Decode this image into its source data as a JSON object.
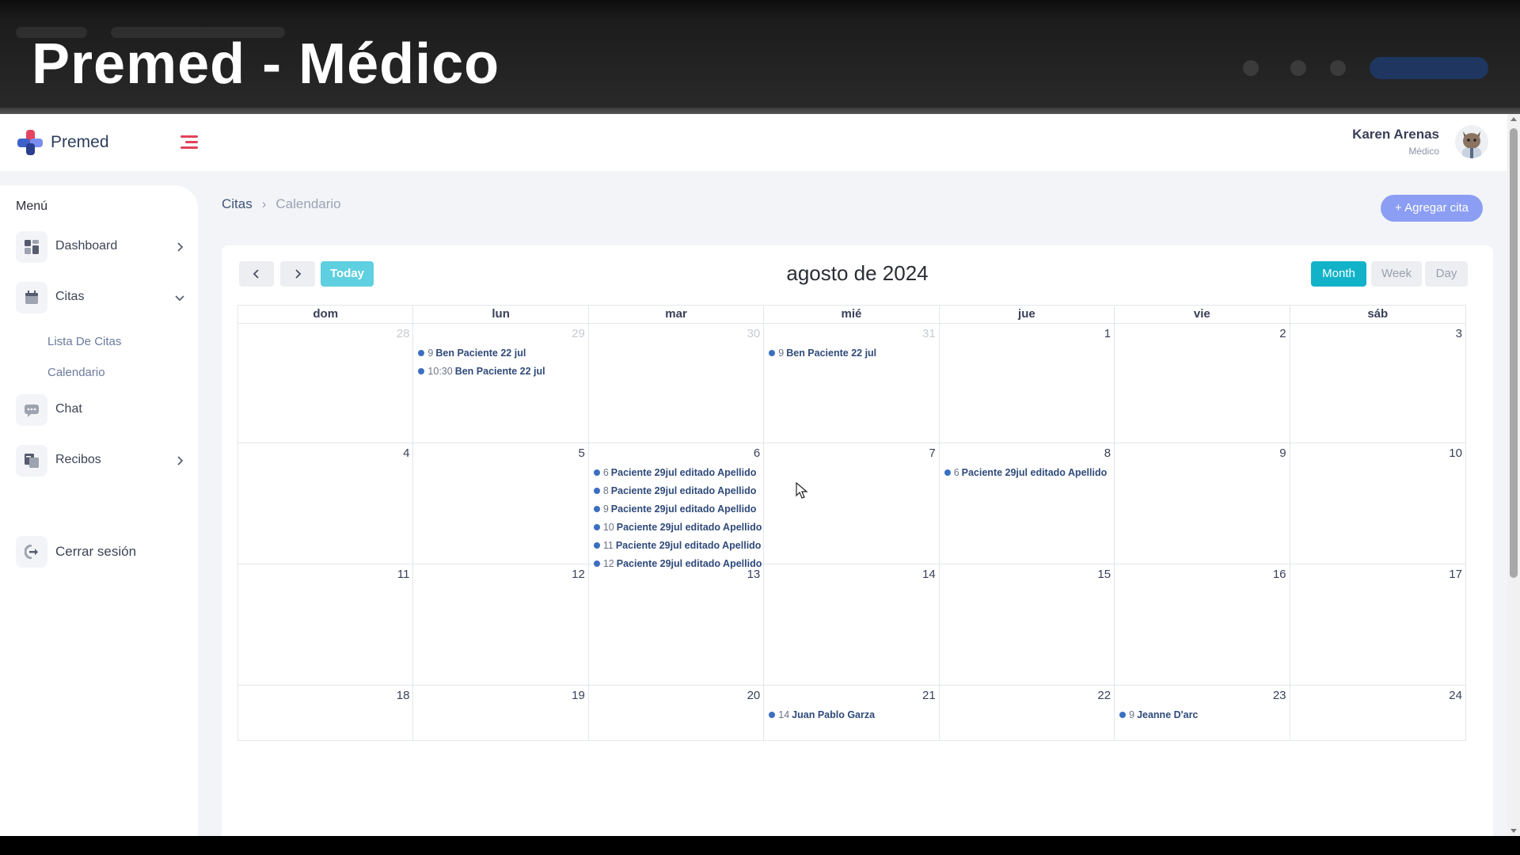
{
  "banner": {
    "title": "Premed - Médico"
  },
  "app": {
    "brand": "Premed",
    "user": {
      "name": "Karen Arenas",
      "role": "Médico"
    }
  },
  "sidebar": {
    "menu_label": "Menú",
    "items": [
      {
        "label": "Dashboard",
        "icon": "dashboard-icon"
      },
      {
        "label": "Citas",
        "icon": "calendar-icon",
        "subitems": [
          "Lista De Citas",
          "Calendario"
        ]
      },
      {
        "label": "Chat",
        "icon": "chat-icon"
      },
      {
        "label": "Recibos",
        "icon": "receipt-icon"
      }
    ],
    "logout": "Cerrar sesión"
  },
  "breadcrumb": {
    "root": "Citas",
    "current": "Calendario"
  },
  "add_button": "+ Agregar cita",
  "calendar": {
    "title": "agosto de 2024",
    "today_label": "Today",
    "views": [
      "Month",
      "Week",
      "Day"
    ],
    "active_view": "Month",
    "weekdays": [
      "dom",
      "lun",
      "mar",
      "mié",
      "jue",
      "vie",
      "sáb"
    ],
    "weeks": [
      [
        {
          "day": "28",
          "other": true,
          "events": []
        },
        {
          "day": "29",
          "other": true,
          "events": [
            {
              "time": "9",
              "title": "Ben Paciente 22 jul"
            },
            {
              "time": "10:30",
              "title": "Ben Paciente 22 jul"
            }
          ]
        },
        {
          "day": "30",
          "other": true,
          "events": []
        },
        {
          "day": "31",
          "other": true,
          "events": [
            {
              "time": "9",
              "title": "Ben Paciente 22 jul"
            }
          ]
        },
        {
          "day": "1",
          "other": false,
          "events": []
        },
        {
          "day": "2",
          "other": false,
          "events": []
        },
        {
          "day": "3",
          "other": false,
          "events": []
        }
      ],
      [
        {
          "day": "4",
          "other": false,
          "events": []
        },
        {
          "day": "5",
          "other": false,
          "events": []
        },
        {
          "day": "6",
          "other": false,
          "events": [
            {
              "time": "6",
              "title": "Paciente 29jul editado Apellido"
            },
            {
              "time": "8",
              "title": "Paciente 29jul editado Apellido"
            },
            {
              "time": "9",
              "title": "Paciente 29jul editado Apellido"
            },
            {
              "time": "10",
              "title": "Paciente 29jul editado Apellido"
            },
            {
              "time": "11",
              "title": "Paciente 29jul editado Apellido"
            },
            {
              "time": "12",
              "title": "Paciente 29jul editado Apellido"
            }
          ]
        },
        {
          "day": "7",
          "other": false,
          "events": []
        },
        {
          "day": "8",
          "other": false,
          "events": [
            {
              "time": "6",
              "title": "Paciente 29jul editado Apellido"
            }
          ]
        },
        {
          "day": "9",
          "other": false,
          "events": []
        },
        {
          "day": "10",
          "other": false,
          "events": []
        }
      ],
      [
        {
          "day": "11",
          "other": false,
          "events": []
        },
        {
          "day": "12",
          "other": false,
          "events": []
        },
        {
          "day": "13",
          "other": false,
          "events": []
        },
        {
          "day": "14",
          "other": false,
          "events": []
        },
        {
          "day": "15",
          "other": false,
          "events": []
        },
        {
          "day": "16",
          "other": false,
          "events": []
        },
        {
          "day": "17",
          "other": false,
          "events": []
        }
      ],
      [
        {
          "day": "18",
          "other": false,
          "events": []
        },
        {
          "day": "19",
          "other": false,
          "events": []
        },
        {
          "day": "20",
          "other": false,
          "events": []
        },
        {
          "day": "21",
          "other": false,
          "events": [
            {
              "time": "14",
              "title": "Juan Pablo Garza"
            }
          ]
        },
        {
          "day": "22",
          "other": false,
          "events": []
        },
        {
          "day": "23",
          "other": false,
          "events": [
            {
              "time": "9",
              "title": "Jeanne D'arc"
            }
          ]
        },
        {
          "day": "24",
          "other": false,
          "events": []
        }
      ]
    ]
  },
  "colors": {
    "accent": "#12b3c9",
    "today": "#5fd0e0",
    "add_button": "#8b9ef4",
    "event_dot": "#3b6fbf",
    "menu_toggle": "#e0435a"
  }
}
